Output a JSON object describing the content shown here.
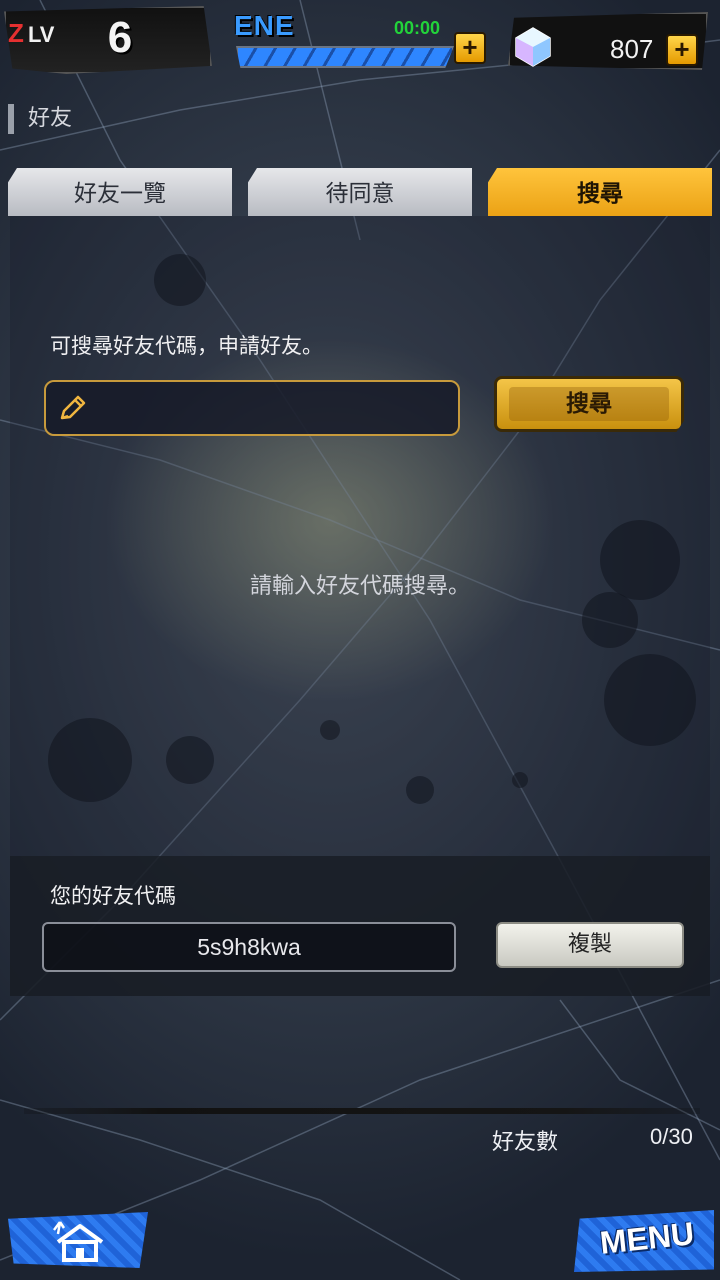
{
  "status_bar": {
    "zlv": {
      "z": "Z",
      "lv": "LV",
      "level": "6"
    },
    "energy": {
      "label": "ENE",
      "timer": "00:00",
      "fill_fraction": 1.0
    },
    "gems": {
      "count": "807"
    },
    "plus_symbol": "+"
  },
  "page": {
    "title": "好友"
  },
  "tabs": [
    {
      "label": "好友一覽",
      "active": false
    },
    {
      "label": "待同意",
      "active": false
    },
    {
      "label": "搜尋",
      "active": true
    }
  ],
  "search": {
    "hint": "可搜尋好友代碼，申請好友。",
    "input_value": "",
    "button_label": "搜尋",
    "empty_message": "請輸入好友代碼搜尋。"
  },
  "friend_code": {
    "label": "您的好友代碼",
    "code": "5s9h8kwa",
    "copy_label": "複製"
  },
  "footer": {
    "friend_count_label": "好友數",
    "friend_count_value": "0/30",
    "menu_label": "MENU"
  },
  "colors": {
    "accent_gold": "#f2b52a",
    "energy_blue": "#2e86ff",
    "timer_green": "#22d33a",
    "nav_blue": "#2e7bf0"
  },
  "icons": {
    "edit": "pencil-icon",
    "home": "home-icon",
    "gem": "gem-icon",
    "plus": "plus-icon"
  }
}
